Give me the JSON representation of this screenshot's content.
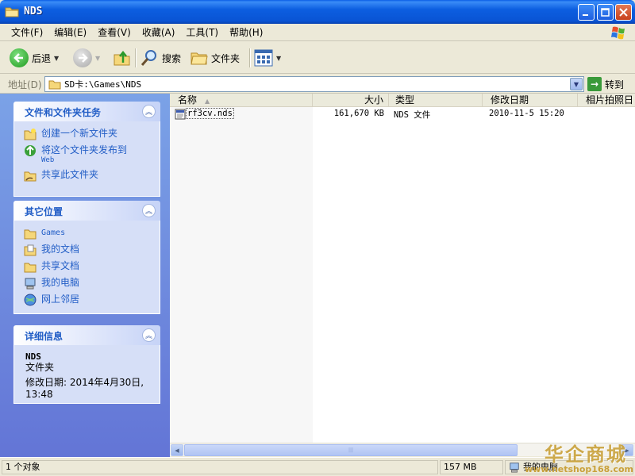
{
  "window": {
    "title": "NDS"
  },
  "menu": [
    "文件(F)",
    "编辑(E)",
    "查看(V)",
    "收藏(A)",
    "工具(T)",
    "帮助(H)"
  ],
  "toolbar": {
    "back_label": "后退",
    "search_label": "搜索",
    "folders_label": "文件夹"
  },
  "address": {
    "label": "地址(D)",
    "path": "SD卡:\\Games\\NDS",
    "go_label": "转到"
  },
  "tasks": {
    "title": "文件和文件夹任务",
    "items": [
      {
        "label": "创建一个新文件夹",
        "icon": "new-folder-icon"
      },
      {
        "label": "将这个文件夹发布到",
        "sub": "Web",
        "icon": "publish-web-icon"
      },
      {
        "label": "共享此文件夹",
        "icon": "share-folder-icon"
      }
    ]
  },
  "places": {
    "title": "其它位置",
    "items": [
      {
        "label": "Games",
        "icon": "folder-icon"
      },
      {
        "label": "我的文档",
        "icon": "my-documents-icon"
      },
      {
        "label": "共享文档",
        "icon": "shared-documents-icon"
      },
      {
        "label": "我的电脑",
        "icon": "my-computer-icon"
      },
      {
        "label": "网上邻居",
        "icon": "network-places-icon"
      }
    ]
  },
  "details": {
    "title": "详细信息",
    "name": "NDS",
    "type": "文件夹",
    "modified_line1": "修改日期: 2014年4月30日,",
    "modified_line2": "13:48"
  },
  "columns": {
    "name": "名称",
    "size": "大小",
    "type": "类型",
    "modified": "修改日期",
    "photo_date": "相片拍照日"
  },
  "files": [
    {
      "name": "rf3cv.nds",
      "size": "161,670 KB",
      "type": "NDS 文件",
      "modified": "2010-11-5 15:20"
    }
  ],
  "status": {
    "objects": "1 个对象",
    "size": "157 MB",
    "location": "我的电脑"
  },
  "watermark": {
    "text": "华企商城",
    "url": "www.netshop168.com"
  },
  "colors": {
    "title_blue": "#0a54d4",
    "task_link": "#215dc6",
    "pane_bg": "#6375d6"
  }
}
